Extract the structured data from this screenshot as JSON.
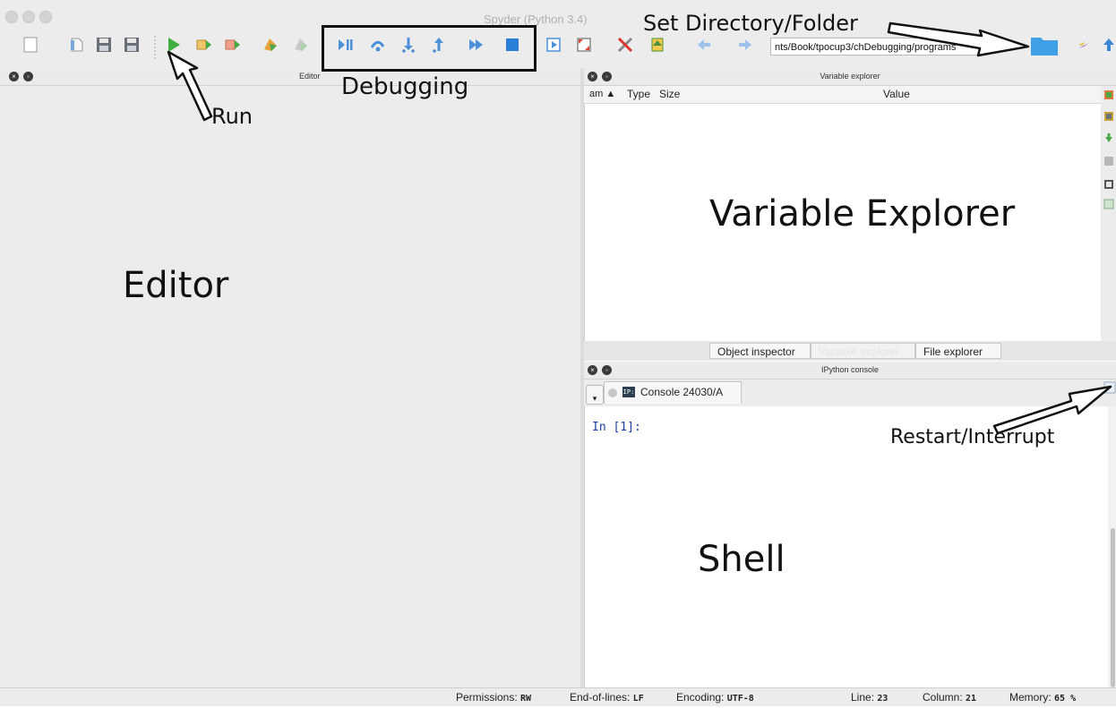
{
  "window": {
    "title": "Spyder (Python 3.4)"
  },
  "toolbar": {
    "working_directory": "nts/Book/tpocup3/chDebugging/programs"
  },
  "panes": {
    "editor": {
      "title": "Editor"
    },
    "variable_explorer": {
      "title": "Variable explorer",
      "columns": [
        "am ▲",
        "Type",
        "Size",
        "Value"
      ]
    },
    "bottom_tabs": [
      "Object inspector",
      "Variable explorer",
      "File explorer"
    ],
    "ipython": {
      "title": "IPython console",
      "console_tab": "Console 24030/A",
      "prompt": "In [1]:"
    }
  },
  "statusbar": {
    "permissions_label": "Permissions:",
    "permissions_value": "RW",
    "eol_label": "End-of-lines:",
    "eol_value": "LF",
    "encoding_label": "Encoding:",
    "encoding_value": "UTF-8",
    "line_label": "Line:",
    "line_value": "23",
    "column_label": "Column:",
    "column_value": "21",
    "memory_label": "Memory:",
    "memory_value": "65 %"
  },
  "annotations": {
    "run": "Run",
    "debugging": "Debugging",
    "set_directory": "Set Directory/Folder",
    "editor": "Editor",
    "variable_explorer": "Variable Explorer",
    "shell": "Shell",
    "restart": "Restart/Interrupt"
  }
}
